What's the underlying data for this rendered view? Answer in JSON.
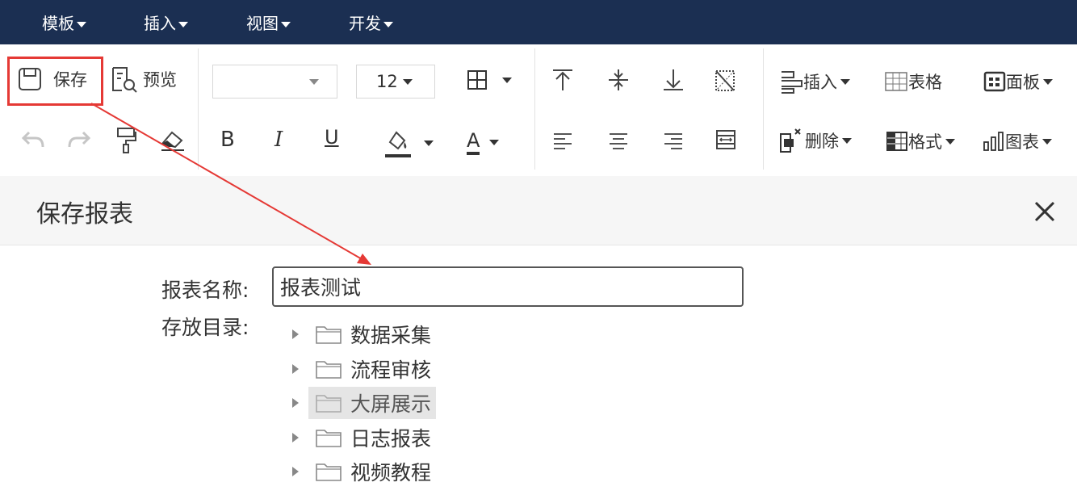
{
  "menubar": {
    "items": [
      {
        "label": "模板"
      },
      {
        "label": "插入"
      },
      {
        "label": "视图"
      },
      {
        "label": "开发"
      }
    ]
  },
  "toolbar": {
    "save_label": "保存",
    "preview_label": "预览",
    "font_size_value": "12",
    "insert_label": "插入",
    "table_label": "表格",
    "panel_label": "面板",
    "delete_label": "删除",
    "format_label": "格式",
    "chart_label": "图表",
    "bold_label": "B",
    "italic_label": "I",
    "underline_label": "U",
    "font_color_label": "A"
  },
  "dialog": {
    "title": "保存报表",
    "name_label": "报表名称:",
    "name_value": "报表测试",
    "directory_label": "存放目录:",
    "folders": [
      {
        "label": "数据采集",
        "selected": false
      },
      {
        "label": "流程审核",
        "selected": false
      },
      {
        "label": "大屏展示",
        "selected": true
      },
      {
        "label": "日志报表",
        "selected": false
      },
      {
        "label": "视频教程",
        "selected": false
      }
    ]
  },
  "colors": {
    "menubar_bg": "#1b2f52",
    "highlight": "#e53935",
    "annotation_arrow": "#e53935"
  }
}
